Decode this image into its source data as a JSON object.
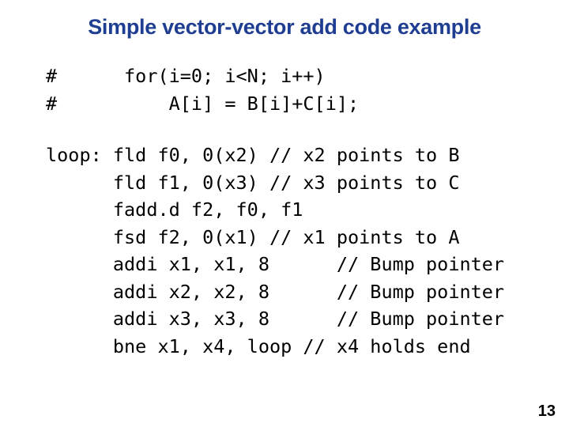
{
  "slide": {
    "title": "Simple vector-vector add code example",
    "title_color": "#1F3E91",
    "background_color": "#FFFFFF",
    "text_color": "#000000",
    "page_number": "13"
  },
  "c_source": {
    "lines": [
      "#      for(i=0; i<N; i++)",
      "#          A[i] = B[i]+C[i];"
    ],
    "joined": "#      for(i=0; i<N; i++)\n#          A[i] = B[i]+C[i];"
  },
  "assembly": {
    "lines": [
      "loop: fld f0, 0(x2) // x2 points to B",
      "      fld f1, 0(x3) // x3 points to C",
      "      fadd.d f2, f0, f1",
      "      fsd f2, 0(x1) // x1 points to A",
      "      addi x1, x1, 8      // Bump pointer",
      "      addi x2, x2, 8      // Bump pointer",
      "      addi x3, x3, 8      // Bump pointer",
      "      bne x1, x4, loop // x4 holds end"
    ],
    "joined": "loop: fld f0, 0(x2) // x2 points to B\n      fld f1, 0(x3) // x3 points to C\n      fadd.d f2, f0, f1\n      fsd f2, 0(x1) // x1 points to A\n      addi x1, x1, 8      // Bump pointer\n      addi x2, x2, 8      // Bump pointer\n      addi x3, x3, 8      // Bump pointer\n      bne x1, x4, loop // x4 holds end"
  }
}
